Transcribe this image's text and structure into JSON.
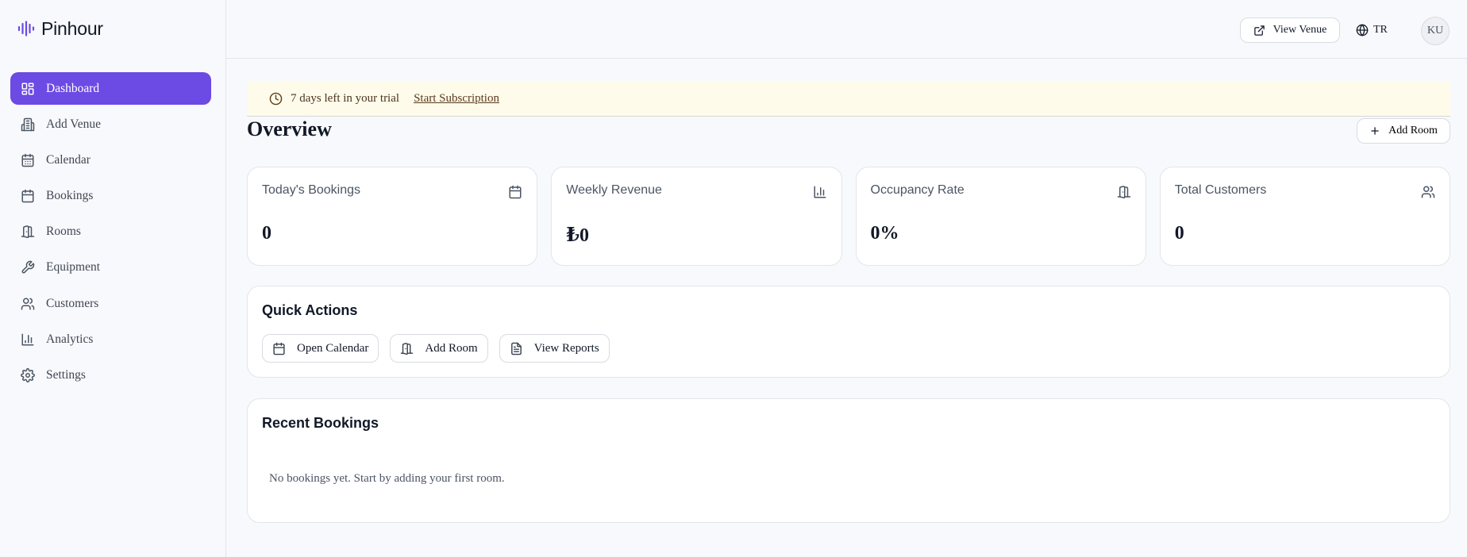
{
  "brand": {
    "name": "Pinhour",
    "accent": "#6c4ae4",
    "logo_icon": "audio-wave-icon"
  },
  "sidebar": {
    "items": [
      {
        "label": "Dashboard",
        "icon": "dashboard-grid-icon",
        "active": true
      },
      {
        "label": "Add Venue",
        "icon": "building-icon"
      },
      {
        "label": "Calendar",
        "icon": "calendar-icon"
      },
      {
        "label": "Bookings",
        "icon": "calendar-icon"
      },
      {
        "label": "Rooms",
        "icon": "door-icon"
      },
      {
        "label": "Equipment",
        "icon": "wrench-icon"
      },
      {
        "label": "Customers",
        "icon": "users-icon"
      },
      {
        "label": "Analytics",
        "icon": "bar-chart-icon"
      },
      {
        "label": "Settings",
        "icon": "gear-icon"
      }
    ]
  },
  "topbar": {
    "view_venue": "View Venue",
    "language": "TR",
    "avatar_initials": "KU"
  },
  "trial": {
    "message": "7 days left in your trial",
    "link": "Start Subscription"
  },
  "overview": {
    "title": "Overview",
    "add_room": "Add Room"
  },
  "stats": [
    {
      "label": "Today's Bookings",
      "value": "0",
      "icon": "calendar-icon"
    },
    {
      "label": "Weekly Revenue",
      "value": "₺0",
      "icon": "bar-chart-icon"
    },
    {
      "label": "Occupancy Rate",
      "value": "0%",
      "icon": "door-icon"
    },
    {
      "label": "Total Customers",
      "value": "0",
      "icon": "users-icon"
    }
  ],
  "quick_actions": {
    "title": "Quick Actions",
    "buttons": [
      {
        "label": "Open Calendar",
        "icon": "calendar-icon"
      },
      {
        "label": "Add Room",
        "icon": "door-icon"
      },
      {
        "label": "View Reports",
        "icon": "file-text-icon"
      }
    ]
  },
  "recent_bookings": {
    "title": "Recent Bookings",
    "empty": "No bookings yet. Start by adding your first room."
  }
}
